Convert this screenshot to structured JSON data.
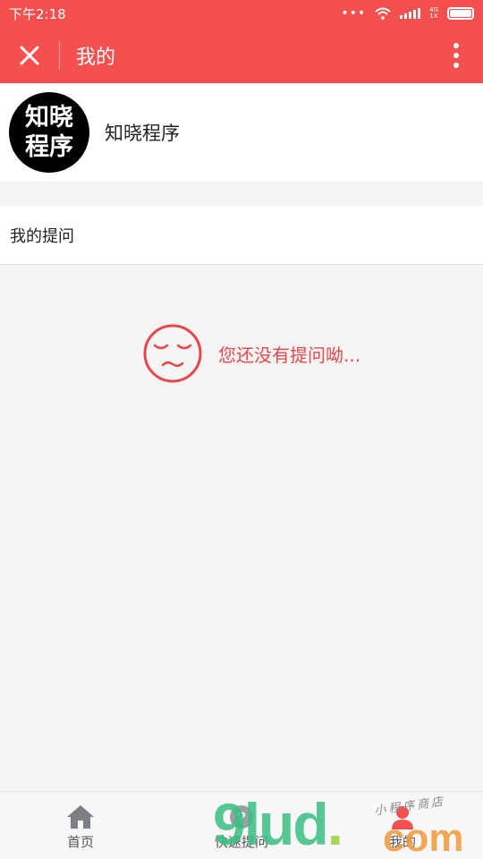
{
  "status_bar": {
    "time": "下午2:18",
    "net_top": "4G",
    "net_bottom": "1X"
  },
  "nav": {
    "title": "我的",
    "close_icon": "close-icon",
    "more_icon": "more-vertical-icon"
  },
  "profile": {
    "avatar_line1": "知晓",
    "avatar_line2": "程序",
    "name": "知晓程序"
  },
  "section": {
    "title": "我的提问"
  },
  "empty_state": {
    "icon": "sad-face-icon",
    "message": "您还没有提问呦..."
  },
  "tabs": [
    {
      "label": "首页",
      "icon": "home-icon"
    },
    {
      "label": "快速提问",
      "icon": "question-icon"
    },
    {
      "label": "我的",
      "icon": "user-icon"
    }
  ],
  "watermark": {
    "logo": "9lud",
    "dot": ".",
    "suffix": "com",
    "tagline": "小程序商店"
  },
  "colors": {
    "brand": "#f55050",
    "empty_text": "#e8474a",
    "background": "#f4f4f4"
  }
}
